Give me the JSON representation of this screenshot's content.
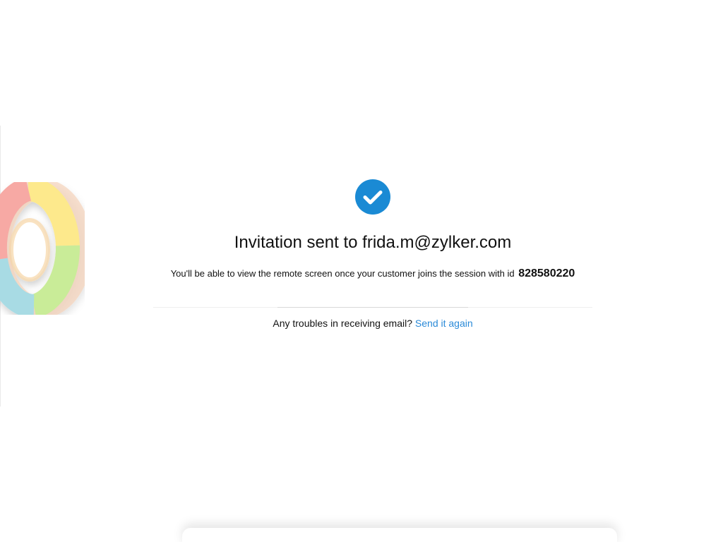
{
  "invitation": {
    "title": "Invitation sent to frida.m@zylker.com",
    "subtitle": "You'll be able to view the remote screen once your customer joins the session with id",
    "session_id": "828580220"
  },
  "resend": {
    "prompt": "Any troubles in receiving email?",
    "link_label": "Send it again"
  },
  "colors": {
    "accent": "#1a8ad4",
    "link": "#2a8ad8"
  },
  "icons": {
    "status": "check-circle-icon",
    "brand": "brand-ring-logo"
  }
}
